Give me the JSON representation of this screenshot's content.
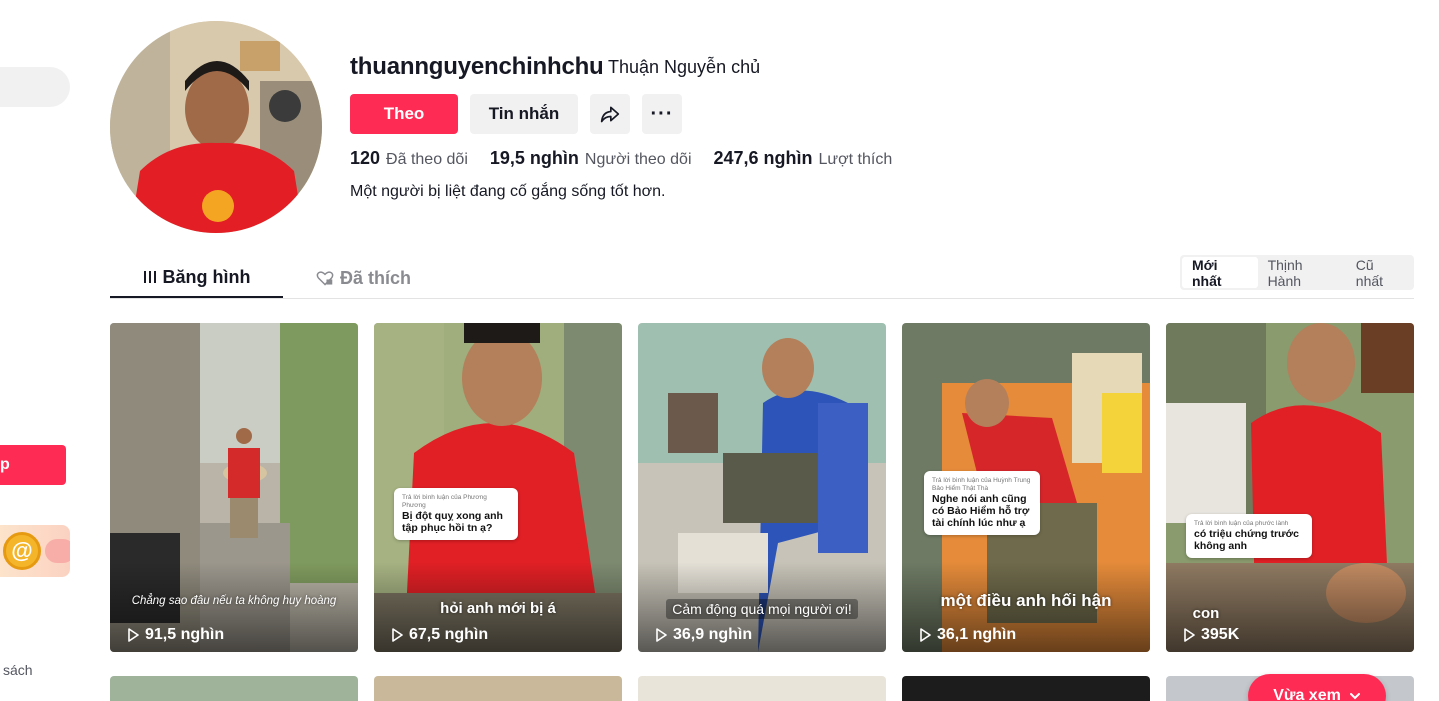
{
  "profile": {
    "username": "thuannguyenchinhchu",
    "nickname": "Thuận Nguyễn chủ",
    "follow_label": "Theo",
    "message_label": "Tin nhắn",
    "more_label": "···",
    "stats": {
      "following_count": "120",
      "following_label": "Đã theo dõi",
      "followers_count": "19,5 nghìn",
      "followers_label": "Người theo dõi",
      "likes_count": "247,6 nghìn",
      "likes_label": "Lượt thích"
    },
    "bio": "Một người bị liệt đang cố gắng sống tốt hơn."
  },
  "sidebar": {
    "button_label": "p",
    "coin_glyph": "@",
    "bottom_text": "sách"
  },
  "tabs": {
    "videos_label": "Băng hình",
    "liked_label": "Đã thích"
  },
  "sort": {
    "options": [
      "Mới nhất",
      "Thịnh Hành",
      "Cũ nhất"
    ],
    "selected": "Mới nhất"
  },
  "videos": [
    {
      "views": "91,5 nghìn",
      "caption": "Chẳng sao đâu nếu ta không huy hoàng"
    },
    {
      "views": "67,5 nghìn",
      "caption": "hỏi anh mới bị á",
      "reply_to": "Trả lời bình luận của Phương Phương",
      "reply_text": "Bị đột quỵ xong anh tập phục hồi tn ạ?"
    },
    {
      "views": "36,9 nghìn",
      "caption": "Cảm động quá mọi người ơi!"
    },
    {
      "views": "36,1 nghìn",
      "caption": "một điều anh hối hận",
      "reply_to": "Trả lời bình luận của Huỳnh Trung Bảo Hiểm Thật Thà",
      "reply_text": "Nghe nói anh cũng có Bảo Hiểm hỗ trợ tài chính lúc như ạ"
    },
    {
      "views": "395K",
      "caption": "con",
      "reply_to": "Trả lời bình luận của phước lành",
      "reply_text": "có triệu chứng trước không anh"
    }
  ],
  "floating_button": {
    "label": "Vừa xem",
    "icon": "chevron-down-icon"
  },
  "colors": {
    "accent": "#fe2c55",
    "secondary_bg": "#f1f1f2",
    "text": "#161823"
  }
}
